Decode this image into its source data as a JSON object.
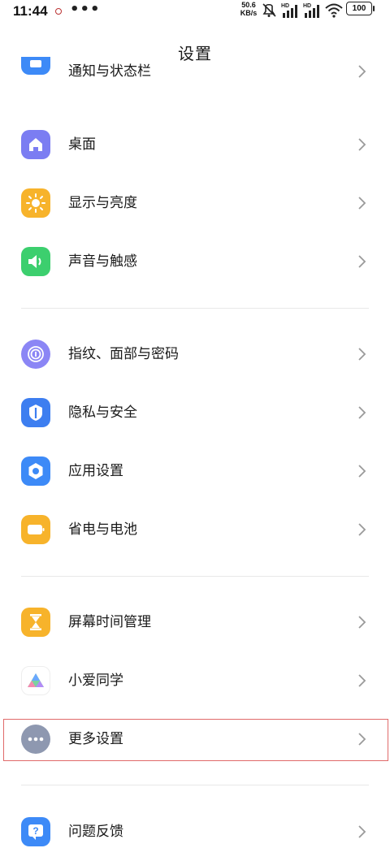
{
  "status_bar": {
    "time": "11:44",
    "more": "•••",
    "net_speed_value": "50.6",
    "net_speed_unit": "KB/s",
    "hd1": "HD",
    "hd2": "HD",
    "battery": "100"
  },
  "page": {
    "title": "设置"
  },
  "settings": {
    "notifications": {
      "label": "通知与状态栏",
      "icon": "notification-icon",
      "color": "#3d8af7"
    },
    "desktop": {
      "label": "桌面",
      "icon": "home-icon",
      "color": "#7b7df2"
    },
    "display": {
      "label": "显示与亮度",
      "icon": "sun-icon",
      "color": "#f7b32b"
    },
    "sound": {
      "label": "声音与触感",
      "icon": "speaker-icon",
      "color": "#3ccf6e"
    },
    "security_fingerprint": {
      "label": "指纹、面部与密码",
      "icon": "fingerprint-icon",
      "color": "#8b86f5"
    },
    "privacy": {
      "label": "隐私与安全",
      "icon": "shield-icon",
      "color": "#3d7ef0"
    },
    "apps": {
      "label": "应用设置",
      "icon": "hexagon-gear-icon",
      "color": "#3d8af7"
    },
    "battery": {
      "label": "省电与电池",
      "icon": "battery-icon",
      "color": "#f7b32b"
    },
    "screen_time": {
      "label": "屏幕时间管理",
      "icon": "hourglass-icon",
      "color": "#f7b32b"
    },
    "xiaoai": {
      "label": "小爱同学",
      "icon": "xiaoai-icon",
      "color": "#ffffff"
    },
    "more": {
      "label": "更多设置",
      "icon": "more-dots-icon",
      "color": "#8e98b0"
    },
    "feedback": {
      "label": "问题反馈",
      "icon": "question-icon",
      "color": "#3d8af7"
    }
  }
}
